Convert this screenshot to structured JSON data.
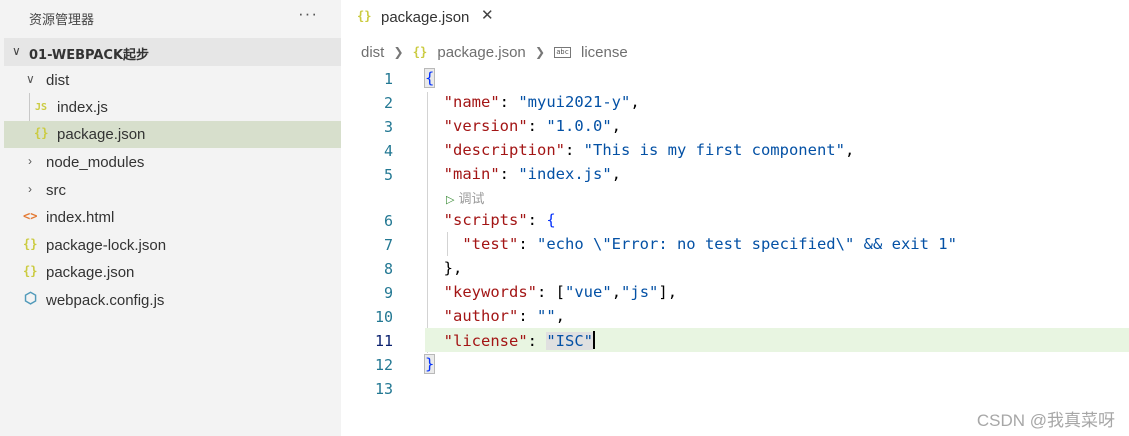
{
  "explorer": {
    "title": "资源管理器",
    "more_icon": "more-icon",
    "project": "01-WEBPACK起步",
    "items": [
      {
        "label": "dist",
        "type": "folder",
        "expanded": true
      },
      {
        "label": "index.js",
        "type": "js",
        "icon_text": "JS"
      },
      {
        "label": "package.json",
        "type": "json",
        "icon_text": "{}",
        "selected": true
      },
      {
        "label": "node_modules",
        "type": "folder",
        "expanded": false
      },
      {
        "label": "src",
        "type": "folder",
        "expanded": false
      },
      {
        "label": "index.html",
        "type": "html",
        "icon_text": "<>"
      },
      {
        "label": "package-lock.json",
        "type": "json",
        "icon_text": "{}"
      },
      {
        "label": "package.json",
        "type": "json",
        "icon_text": "{}"
      },
      {
        "label": "webpack.config.js",
        "type": "webpack",
        "icon_text": "⬡"
      }
    ]
  },
  "tab": {
    "icon_text": "{}",
    "label": "package.json",
    "close": "✕"
  },
  "breadcrumb": {
    "segments": [
      "dist",
      "package.json",
      "license"
    ],
    "abc_text": "abc",
    "json_icon": "{}"
  },
  "codelens": {
    "label": "调试"
  },
  "lines": {
    "n1": "1",
    "n2": "2",
    "n3": "3",
    "n4": "4",
    "n5": "5",
    "n6": "6",
    "n7": "7",
    "n8": "8",
    "n9": "9",
    "n10": "10",
    "n11": "11",
    "n12": "12",
    "n13": "13",
    "l1_open": "{",
    "l2_key": "\"name\"",
    "l2_val": "\"myui2021-y\"",
    "l3_key": "\"version\"",
    "l3_val": "\"1.0.0\"",
    "l4_key": "\"description\"",
    "l4_val": "\"This is my first component\"",
    "l5_key": "\"main\"",
    "l5_val": "\"index.js\"",
    "l6_key": "\"scripts\"",
    "l6_open": "{",
    "l7_key": "\"test\"",
    "l7_val": "\"echo \\\"Error: no test specified\\\" && exit 1\"",
    "l8_close": "},",
    "l9_key": "\"keywords\"",
    "l9_open": "[",
    "l9_v1": "\"vue\"",
    "l9_v2": "\"js\"",
    "l9_close": "],",
    "l10_key": "\"author\"",
    "l10_val": "\"\"",
    "l11_key": "\"license\"",
    "l11_val": "\"ISC\"",
    "l12_close": "}"
  },
  "watermark": "CSDN @我真菜呀",
  "colors": {
    "sidebar_bg": "#f3f3f3",
    "selected_row": "#d7dfcc",
    "current_line": "#e8f5e1",
    "json_key": "#a31515",
    "json_string": "#0451a5",
    "line_number": "#237893"
  }
}
